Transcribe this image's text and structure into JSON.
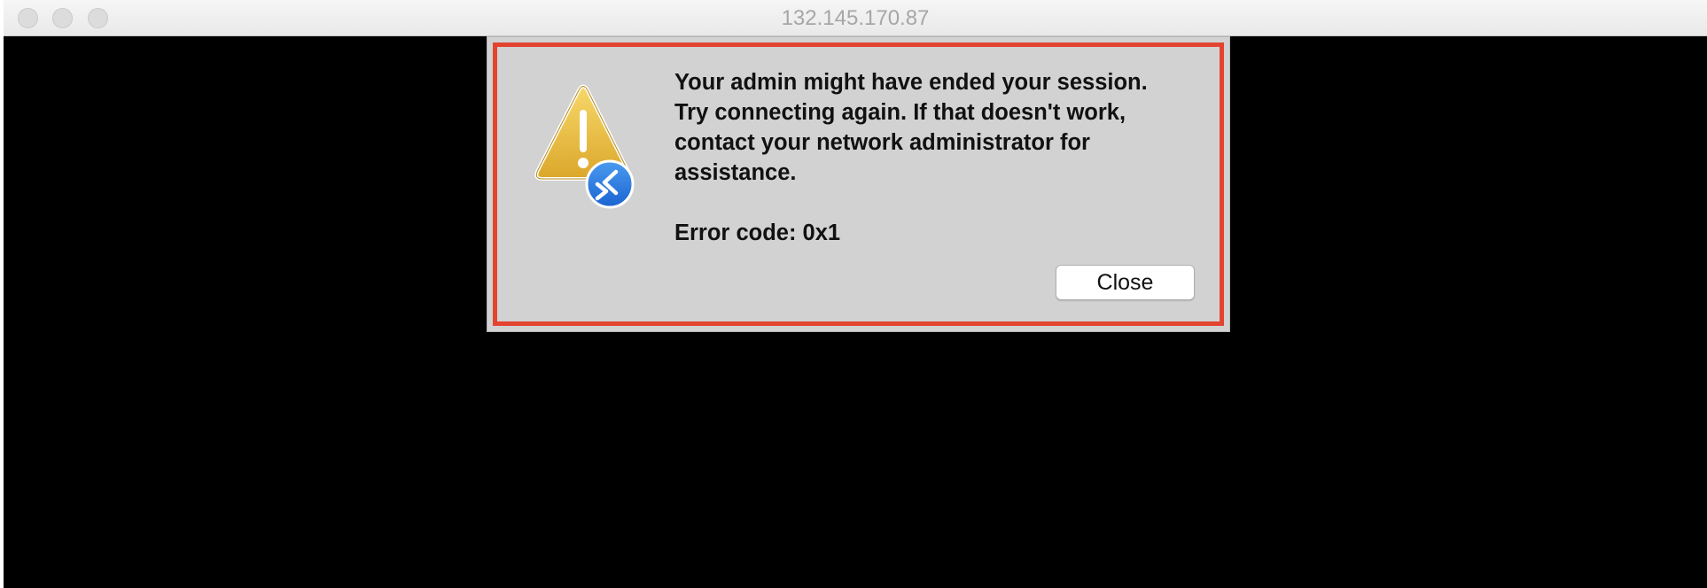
{
  "window": {
    "title": "132.145.170.87"
  },
  "dialog": {
    "message": "Your admin might have ended your session.\nTry connecting again. If that doesn't work,\ncontact your network administrator for\nassistance.",
    "error_code": "Error code: 0x1",
    "close_label": "Close",
    "highlight_color": "#e2442f",
    "icon": "warning-triangle-icon with remote-desktop-badge-icon"
  }
}
